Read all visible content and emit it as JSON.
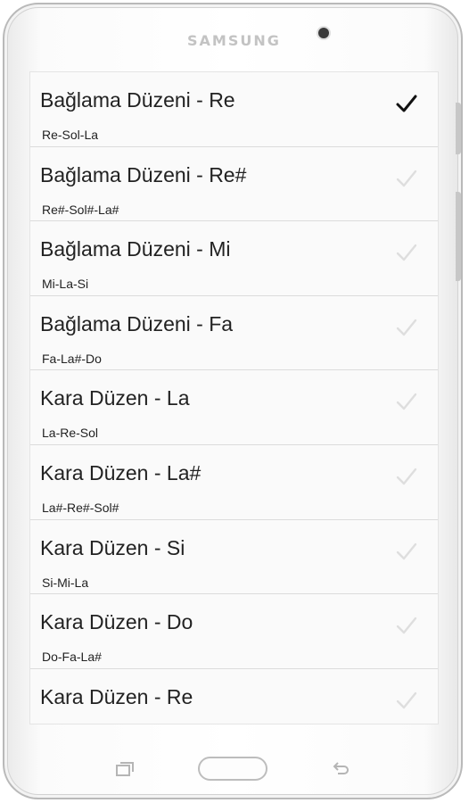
{
  "device": {
    "brand": "SAMSUNG"
  },
  "tunings": {
    "selected_index": 0,
    "colors": {
      "checked": "#111111",
      "unchecked": "#dedede"
    },
    "items": [
      {
        "title": "Bağlama Düzeni - Re",
        "notes": "Re-Sol-La",
        "checked": true
      },
      {
        "title": "Bağlama Düzeni - Re#",
        "notes": "Re#-Sol#-La#",
        "checked": false
      },
      {
        "title": "Bağlama Düzeni - Mi",
        "notes": "Mi-La-Si",
        "checked": false
      },
      {
        "title": "Bağlama Düzeni - Fa",
        "notes": "Fa-La#-Do",
        "checked": false
      },
      {
        "title": "Kara Düzen - La",
        "notes": "La-Re-Sol",
        "checked": false
      },
      {
        "title": "Kara Düzen - La#",
        "notes": "La#-Re#-Sol#",
        "checked": false
      },
      {
        "title": "Kara Düzen - Si",
        "notes": "Si-Mi-La",
        "checked": false
      },
      {
        "title": "Kara Düzen - Do",
        "notes": "Do-Fa-La#",
        "checked": false
      },
      {
        "title": "Kara Düzen - Re",
        "notes": "",
        "checked": false
      }
    ]
  },
  "nav": {
    "recent_icon": "recent-apps-icon",
    "home_icon": "home-button",
    "back_icon": "back-arrow-icon"
  }
}
